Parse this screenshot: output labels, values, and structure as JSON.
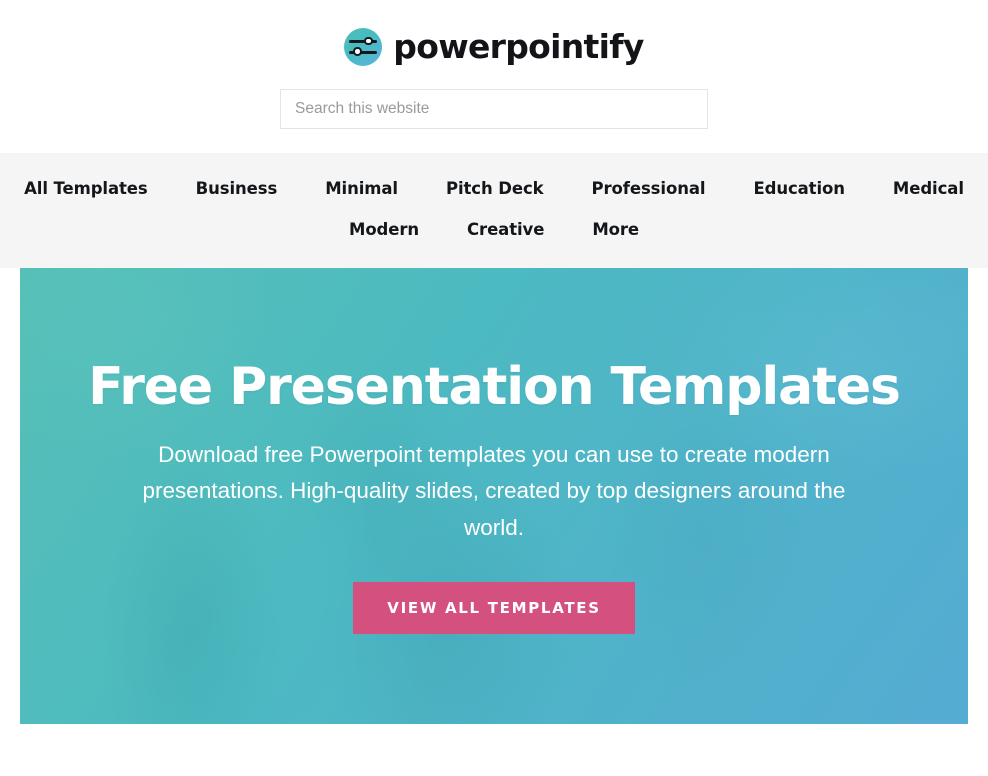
{
  "header": {
    "logo": {
      "icon": "sliders-circle-icon",
      "brand": "powerpointify"
    },
    "search": {
      "placeholder": "Search this website",
      "value": ""
    }
  },
  "nav": {
    "items": [
      {
        "label": "All Templates"
      },
      {
        "label": "Business"
      },
      {
        "label": "Minimal"
      },
      {
        "label": "Pitch Deck"
      },
      {
        "label": "Professional"
      },
      {
        "label": "Education"
      },
      {
        "label": "Medical"
      },
      {
        "label": "Modern"
      },
      {
        "label": "Creative"
      },
      {
        "label": "More"
      }
    ]
  },
  "hero": {
    "title": "Free Presentation Templates",
    "subtitle": "Download free Powerpoint templates you can use to create modern presentations. High-quality slides, created by top designers around the world.",
    "cta_label": "VIEW ALL TEMPLATES"
  },
  "colors": {
    "nav_background": "#f5f5f6",
    "hero_gradient_start": "#4dbfb4",
    "hero_gradient_end": "#53afd8",
    "cta_pink": "#d4507f",
    "text_dark": "#14171a",
    "placeholder_gray": "#9a9a9a"
  }
}
